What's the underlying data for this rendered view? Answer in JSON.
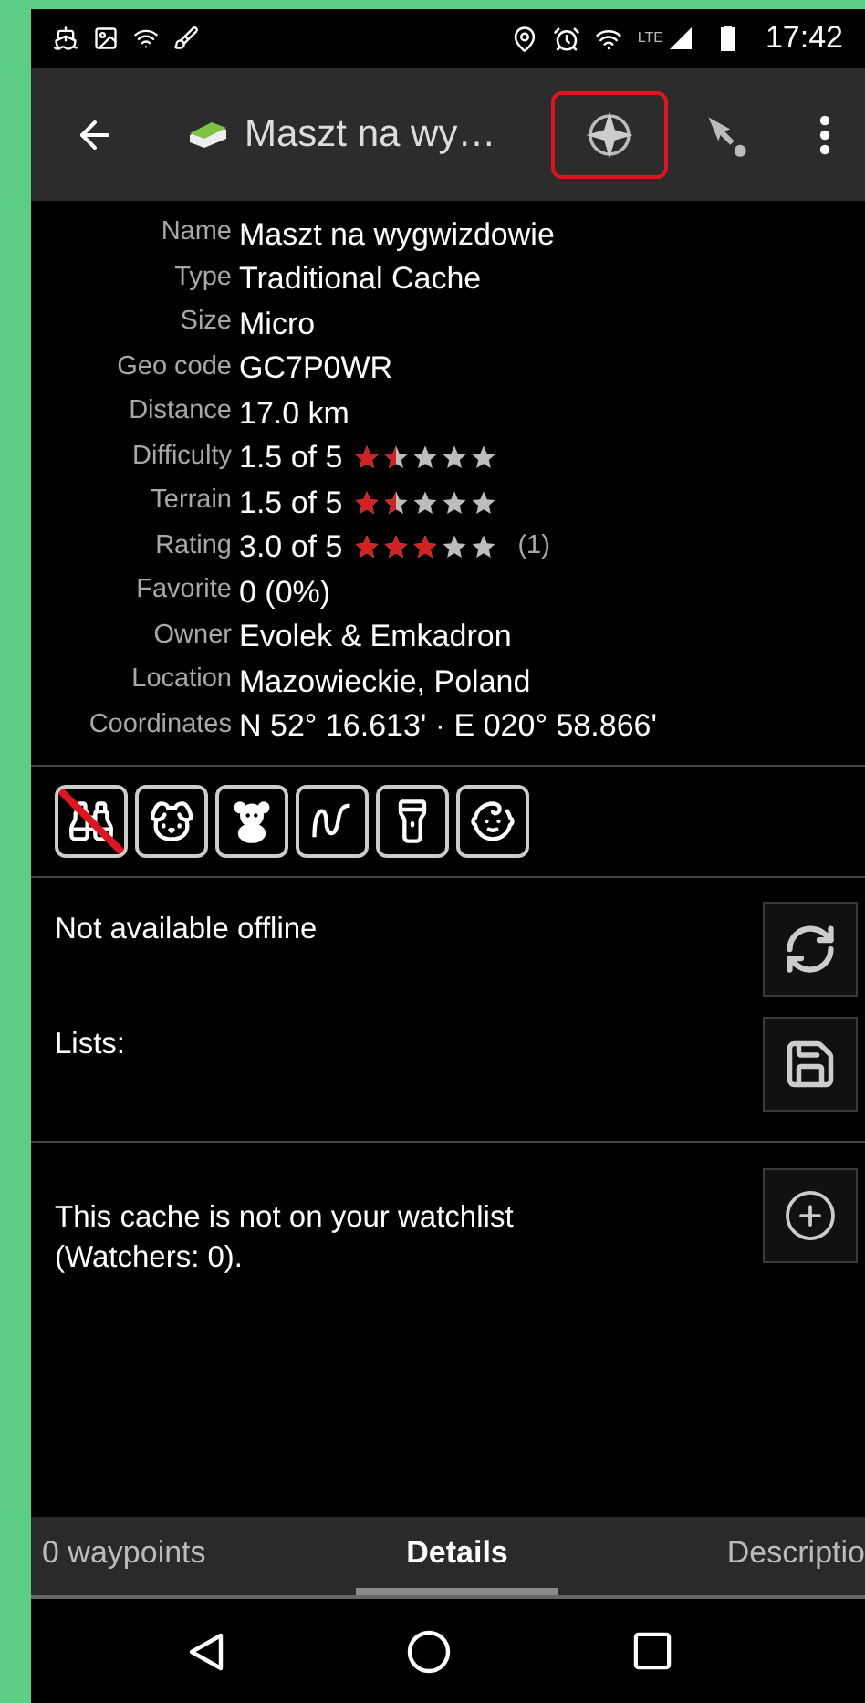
{
  "status_bar": {
    "network": "LTE",
    "time": "17:42"
  },
  "toolbar": {
    "title": "Maszt na wy…",
    "actions": [
      {
        "kind": "compass",
        "highlighted": true
      },
      {
        "kind": "navigate",
        "highlighted": false
      },
      {
        "kind": "overflow",
        "highlighted": false
      }
    ]
  },
  "details": [
    {
      "label": "Name",
      "value": "Maszt na wygwizdowie"
    },
    {
      "label": "Type",
      "value": "Traditional Cache"
    },
    {
      "label": "Size",
      "value": "Micro"
    },
    {
      "label": "Geo code",
      "value": "GC7P0WR"
    },
    {
      "label": "Distance",
      "value": "17.0 km"
    },
    {
      "label": "Difficulty",
      "value": "1.5 of 5",
      "stars": 1.5
    },
    {
      "label": "Terrain",
      "value": "1.5 of 5",
      "stars": 1.5
    },
    {
      "label": "Rating",
      "value": "3.0 of 5",
      "stars": 3,
      "count": "(1)"
    },
    {
      "label": "Favorite",
      "value": "0 (0%)"
    },
    {
      "label": "Owner",
      "value": "Evolek & Emkadron"
    },
    {
      "label": "Location",
      "value": "Mazowieckie, Poland"
    },
    {
      "label": "Coordinates",
      "value": "N 52° 16.613' · E 020° 58.866'"
    }
  ],
  "attributes": [
    {
      "negated": true
    },
    {
      "negated": false
    },
    {
      "negated": false
    },
    {
      "negated": false
    },
    {
      "negated": false
    },
    {
      "negated": false
    }
  ],
  "offline": {
    "text": "Not available offline"
  },
  "lists": {
    "text": "Lists:"
  },
  "watchlist": {
    "text": "This cache is not on your watchlist (Watchers: 0)."
  },
  "tabs": [
    {
      "label": "0 waypoints",
      "selected": false
    },
    {
      "label": "Details",
      "selected": true
    },
    {
      "label": "Descriptio",
      "selected": false
    }
  ]
}
